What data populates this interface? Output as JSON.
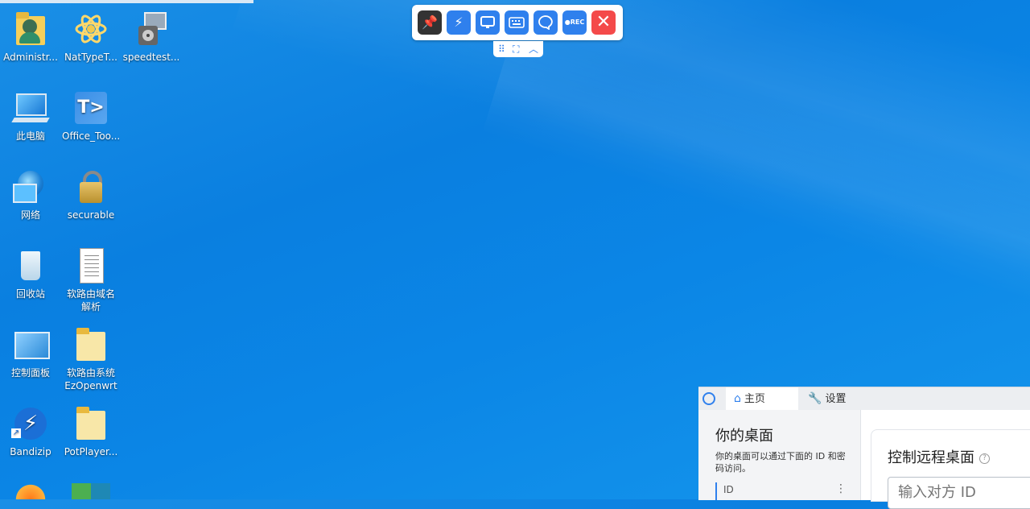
{
  "desktop": {
    "icons": [
      {
        "label": "Administr...",
        "icon": "user-folder-icon"
      },
      {
        "label": "NatTypeT...",
        "icon": "atom-icon"
      },
      {
        "label": "speedtest...",
        "icon": "installer-icon"
      },
      {
        "label": "此电脑",
        "icon": "computer-icon"
      },
      {
        "label": "Office_Too...",
        "icon": "office-tool-icon"
      },
      {
        "label": "网络",
        "icon": "network-icon"
      },
      {
        "label": "securable",
        "icon": "lock-icon"
      },
      {
        "label": "回收站",
        "icon": "recycle-bin-icon"
      },
      {
        "label": "软路由域名解析",
        "icon": "text-document-icon"
      },
      {
        "label": "控制面板",
        "icon": "control-panel-icon"
      },
      {
        "label": "软路由系统EzOpenwrt",
        "icon": "folder-icon"
      },
      {
        "label": "Bandizip",
        "icon": "bandizip-icon"
      },
      {
        "label": "PotPlayer...",
        "icon": "folder-icon"
      }
    ]
  },
  "toolbar": {
    "buttons": [
      {
        "name": "pin",
        "icon": "pin-icon",
        "color": "#333333"
      },
      {
        "name": "action",
        "icon": "lightning-icon",
        "color": "#2f80ed"
      },
      {
        "name": "display",
        "icon": "monitor-icon",
        "color": "#2f80ed"
      },
      {
        "name": "keyboard",
        "icon": "keyboard-icon",
        "color": "#2f80ed"
      },
      {
        "name": "chat",
        "icon": "chat-icon",
        "color": "#2f80ed"
      },
      {
        "name": "record",
        "icon": "record-icon",
        "label": "●REC",
        "color": "#2f80ed"
      },
      {
        "name": "close",
        "icon": "close-icon",
        "color": "#f44a4a"
      }
    ]
  },
  "rustdesk": {
    "tabs": [
      {
        "label": "主页",
        "icon": "home-icon"
      },
      {
        "label": "设置",
        "icon": "wrench-icon"
      }
    ],
    "your_desktop_title": "你的桌面",
    "your_desktop_desc": "你的桌面可以通过下面的 ID 和密码访问。",
    "id_label": "ID",
    "control_title": "控制远程桌面",
    "remote_id_placeholder": "输入对方 ID"
  }
}
